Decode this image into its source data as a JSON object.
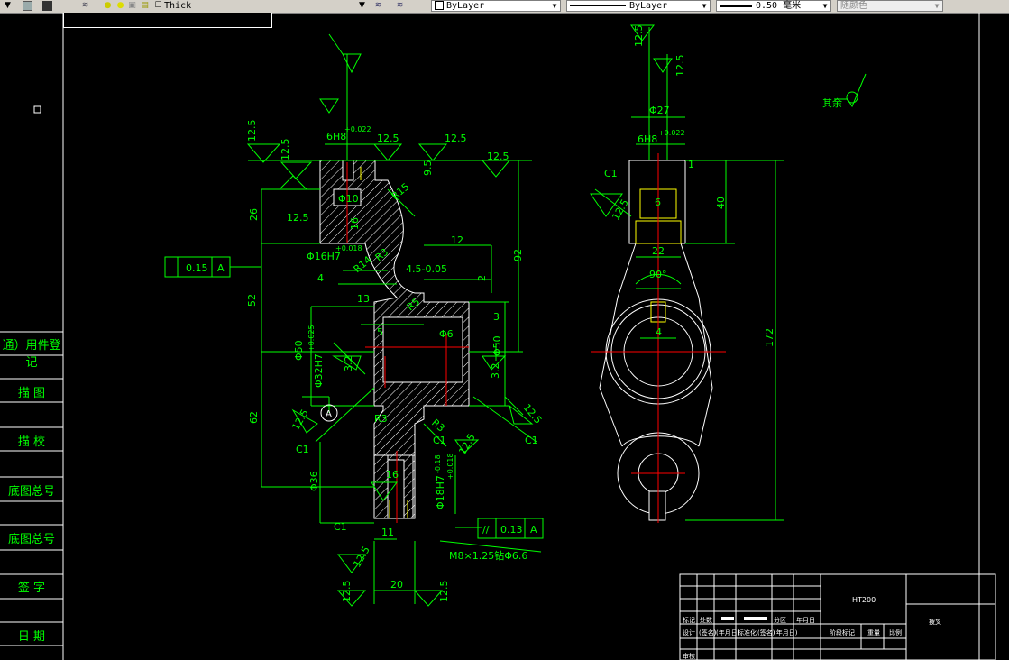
{
  "toolbar": {
    "linetype_value": "Thick",
    "layer_color_value": "ByLayer",
    "linetype_combo_value": "ByLayer",
    "lineweight_value": "0.50 毫米",
    "plotstyle_value": "随颜色"
  },
  "sidebar": {
    "labels": [
      "通）用件登记",
      "描  图",
      "描  校",
      "底图总号",
      "底图总号",
      "签  字",
      "日  期"
    ]
  },
  "drawing": {
    "left_view": {
      "dims": [
        "12.5",
        "12.5",
        "12.5",
        "12.5",
        "12.5",
        "12.5",
        "6H8",
        "+0.022",
        "9.5",
        "Φ10",
        "R15",
        "26",
        "16",
        "Φ16H7",
        "+0.018",
        "12",
        "R3",
        "R14",
        "4.5-0.05",
        "2",
        "52",
        "4",
        "13",
        "R5",
        "3",
        "92",
        "5",
        "Φ6",
        "Φ50",
        "Φ32H7",
        "+0.025",
        "3.2",
        "3.2",
        "Φ50",
        "12.5",
        "12.5",
        "62",
        "R3",
        "R3",
        "C1",
        "C1",
        "C1",
        "12.5",
        "Φ36",
        "16",
        "-0.18",
        "Φ18H7",
        "+0.018",
        "11",
        "C1",
        "12.5",
        "20",
        "12.5",
        "12.5",
        "M8×1.25钻Φ6.6"
      ],
      "tolerance_frame_left": [
        "0.15",
        "A"
      ],
      "tolerance_frame_bottom": [
        "//",
        "0.13",
        "A"
      ],
      "datum": "A"
    },
    "right_view": {
      "dims": [
        "12.5",
        "12.5",
        "Φ27",
        "6H8",
        "+0.022",
        "1",
        "C1",
        "12.5",
        "40",
        "6",
        "22",
        "90°",
        "172",
        "4"
      ],
      "roughness_note": "其余"
    }
  },
  "title_block": {
    "material": "HT200",
    "part_name": "拨叉",
    "row_labels": [
      "标记",
      "处数",
      "分区",
      "更改文件号",
      "签名",
      "年月日"
    ],
    "design_row": [
      "设计",
      "(签名)",
      "(年月日)",
      "标准化",
      "(签名)",
      "(年月日)",
      "阶段标记",
      "重量",
      "比例"
    ],
    "review_label": "审核"
  },
  "colors": {
    "green": "#00ff00",
    "white": "#ffffff",
    "yellow": "#ffff00",
    "red": "#ff0000"
  }
}
